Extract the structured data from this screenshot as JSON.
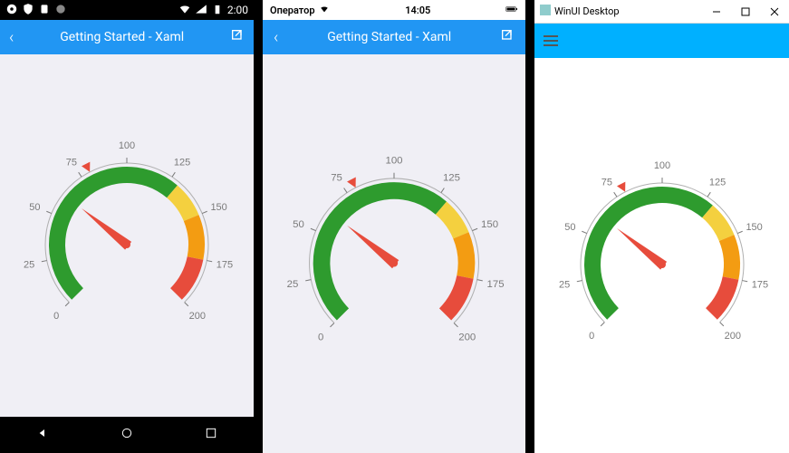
{
  "android": {
    "status_time": "2:00",
    "title": "Getting Started - Xaml"
  },
  "ios": {
    "carrier": "Оператор",
    "time": "14:05",
    "title": "Getting Started - Xaml"
  },
  "win": {
    "window_title": "WinUI Desktop"
  },
  "chart_data": {
    "type": "gauge",
    "min": 0,
    "max": 200,
    "start_angle": 225,
    "end_angle": -45,
    "ticks": [
      0,
      25,
      50,
      75,
      100,
      125,
      150,
      175,
      200
    ],
    "needle_value": 62,
    "marker_value": 80,
    "ranges": [
      {
        "start": 0,
        "end": 130,
        "color": "#2E9B2E"
      },
      {
        "start": 130,
        "end": 150,
        "color": "#F4D03F"
      },
      {
        "start": 150,
        "end": 175,
        "color": "#F39C12"
      },
      {
        "start": 175,
        "end": 200,
        "color": "#E74C3C"
      }
    ]
  }
}
